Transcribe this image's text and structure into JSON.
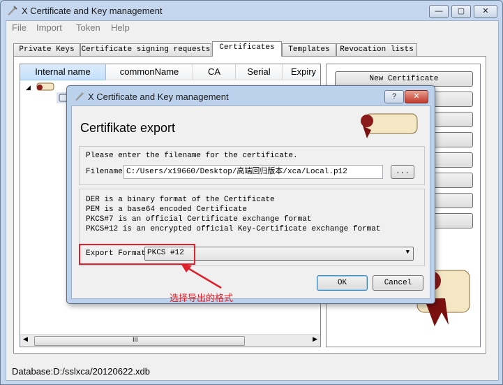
{
  "window": {
    "title": "X Certificate and Key management"
  },
  "menu": [
    "File",
    "Import",
    "Token",
    "Help"
  ],
  "tabs": [
    "Private Keys",
    "Certificate signing requests",
    "Certificates",
    "Templates",
    "Revocation lists"
  ],
  "active_tab": "Certificates",
  "table": {
    "columns": [
      "Internal name",
      "commonName",
      "CA",
      "Serial",
      "Expiry"
    ],
    "scroll_glyph": "III"
  },
  "side_buttons": {
    "first_label": "New Certificate"
  },
  "status": {
    "database": "Database:D:/sslxca/20120622.xdb"
  },
  "dialog": {
    "title": "X Certificate and Key management",
    "heading": "Certifikate export",
    "prompt": "Please enter the filename for the certificate.",
    "filename_label": "Filename",
    "filename_value": "C:/Users/x19660/Desktop/高端回归版本/xca/Local.p12",
    "browse_label": "...",
    "info_lines": [
      "DER is a binary format of the Certificate",
      "PEM is a base64 encoded Certificate",
      "PKCS#7 is an official Certificate exchange format",
      "PKCS#12 is an encrypted official Key-Certificate exchange format"
    ],
    "format_label": "Export Format",
    "format_value": "PKCS #12",
    "ok_label": "OK",
    "cancel_label": "Cancel",
    "help_glyph": "?",
    "close_glyph": "✕"
  },
  "annotation": {
    "text": "选择导出的格式",
    "color": "#e0202a"
  },
  "caption_buttons": {
    "min": "—",
    "max": "▢",
    "close": "✕"
  }
}
